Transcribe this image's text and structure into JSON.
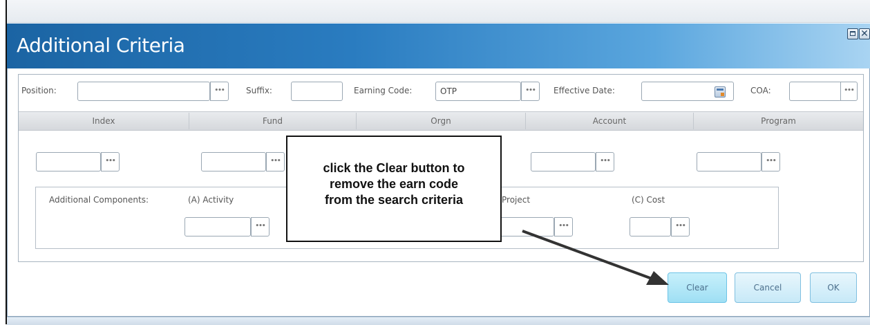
{
  "dialog": {
    "title": "Additional Criteria"
  },
  "top_fields": {
    "position_label": "Position:",
    "position_value": "",
    "suffix_label": "Suffix:",
    "suffix_value": "",
    "earning_code_label": "Earning Code:",
    "earning_code_value": "OTP",
    "effective_date_label": "Effective Date:",
    "effective_date_value": "",
    "coa_label": "COA:",
    "coa_value": ""
  },
  "grid_headers": [
    "Index",
    "Fund",
    "Orgn",
    "Account",
    "Program"
  ],
  "additional_components": {
    "label": "Additional Components:",
    "activity_label": "(A) Activity",
    "project_label": "Project",
    "cost_label": "(C) Cost"
  },
  "callout": {
    "text": "click the Clear button to\nremove the earn code\nfrom the search criteria"
  },
  "buttons": {
    "ellipsis": "•••",
    "clear": "Clear",
    "cancel": "Cancel",
    "ok": "OK"
  },
  "colors": {
    "title_bar_start": "#1b64a3",
    "title_bar_end": "#a9d4f2",
    "button_fill": "#c7e9f8",
    "arrow": "#333333"
  }
}
